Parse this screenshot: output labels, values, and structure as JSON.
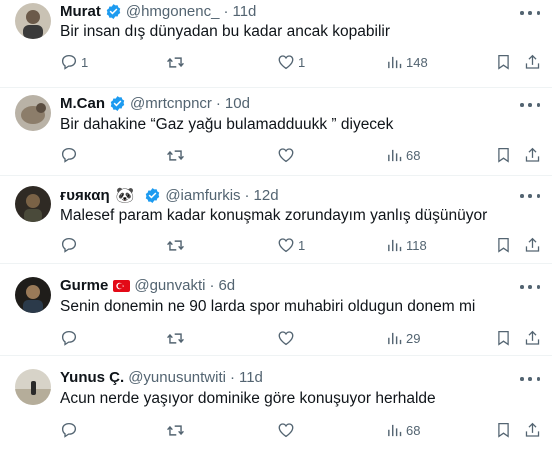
{
  "colors": {
    "text": "#0f1419",
    "secondary": "#536471",
    "verified": "#1d9bf0",
    "divider": "#eff3f4"
  },
  "tweets": [
    {
      "name": "Murat",
      "handle": "@hmgonenc_",
      "time": "11d",
      "verified": true,
      "text": "Bir insan dış dünyadan bu kadar ancak kopabilir",
      "replies": "1",
      "retweets": "",
      "likes": "1",
      "views": "148"
    },
    {
      "name": "M.Can",
      "handle": "@mrtcnpncr",
      "time": "10d",
      "verified": true,
      "text": "Bir dahakine “Gaz yağu bulamadduukk ” diyecek",
      "replies": "",
      "retweets": "",
      "likes": "",
      "views": "68"
    },
    {
      "name": "ғυякαη",
      "name_emoji": "🐼",
      "handle": "@iamfurkis",
      "time": "12d",
      "verified": true,
      "text": "Malesef param kadar konuşmak zorundayım yanlış düşünüyor",
      "replies": "",
      "retweets": "",
      "likes": "1",
      "views": "118"
    },
    {
      "name": "Gurme",
      "name_emoji": "🇹🇷",
      "handle": "@gunvakti",
      "time": "6d",
      "verified": false,
      "text": "Senin donemin ne 90 larda spor muhabiri oldugun donem mi",
      "replies": "",
      "retweets": "",
      "likes": "",
      "views": "29"
    },
    {
      "name": "Yunus Ç.",
      "handle": "@yunusuntwiti",
      "time": "11d",
      "verified": false,
      "text": "Acun nerde yaşıyor dominike göre konuşuyor herhalde",
      "replies": "",
      "retweets": "",
      "likes": "",
      "views": "68"
    }
  ]
}
